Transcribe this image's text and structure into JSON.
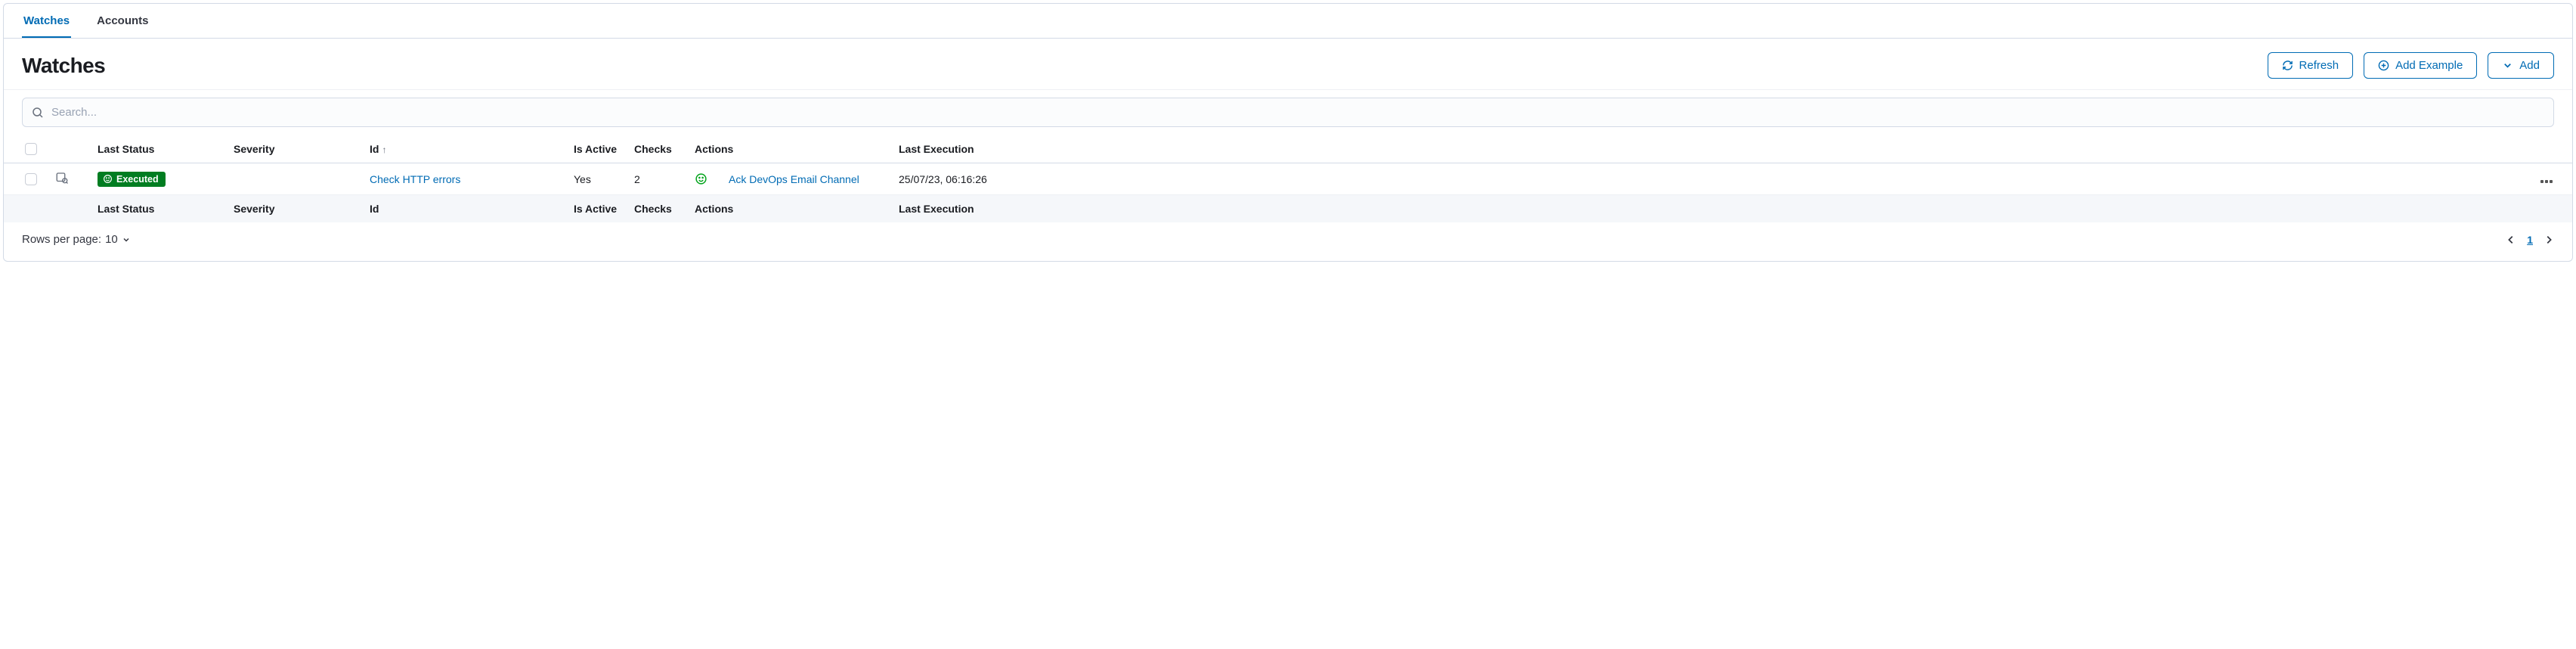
{
  "tabs": [
    {
      "label": "Watches",
      "active": true
    },
    {
      "label": "Accounts",
      "active": false
    }
  ],
  "page": {
    "title": "Watches",
    "refresh_label": "Refresh",
    "add_example_label": "Add Example",
    "add_label": "Add"
  },
  "search": {
    "placeholder": "Search..."
  },
  "columns": {
    "last_status": "Last Status",
    "severity": "Severity",
    "id": "Id",
    "is_active": "Is Active",
    "checks": "Checks",
    "actions": "Actions",
    "last_execution": "Last Execution"
  },
  "sort": {
    "column": "id",
    "dir": "asc"
  },
  "rows": [
    {
      "status": "Executed",
      "status_icon": "smile",
      "severity": "",
      "id": "Check HTTP errors",
      "is_active": "Yes",
      "checks": "2",
      "action_icon": "smile",
      "action_label": "Ack DevOps Email Channel",
      "last_execution": "25/07/23, 06:16:26"
    }
  ],
  "pagination": {
    "rows_per_page_label": "Rows per page:",
    "rows_per_page_value": "10",
    "current_page": "1"
  }
}
